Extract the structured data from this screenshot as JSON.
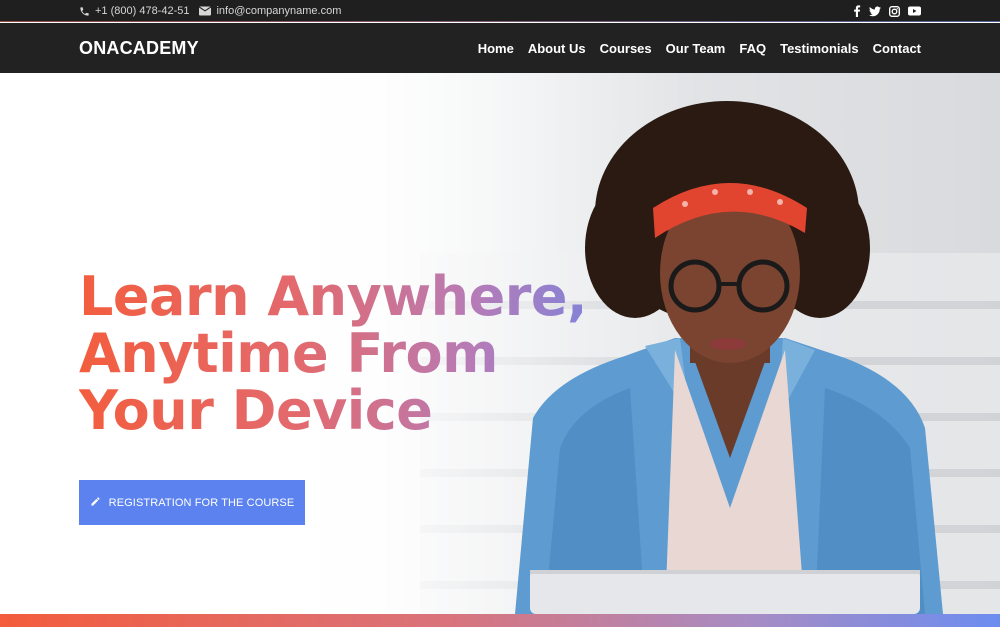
{
  "topbar": {
    "phone": "+1 (800) 478-42-51",
    "email": "info@companyname.com",
    "socials": [
      "facebook-icon",
      "twitter-icon",
      "instagram-icon",
      "youtube-icon"
    ]
  },
  "navbar": {
    "logo": "ONACADEMY",
    "links": [
      "Home",
      "About Us",
      "Courses",
      "Our Team",
      "FAQ",
      "Testimonials",
      "Contact"
    ]
  },
  "hero": {
    "headline": [
      "Learn Anywhere,",
      "Anytime From",
      "Your Device"
    ],
    "cta_label": "REGISTRATION FOR THE COURSE"
  },
  "colors": {
    "topbar_bg": "#1f1f1f",
    "navbar_bg": "#222222",
    "cta_bg": "#5b82ee",
    "gradient_start": "#f35d3e",
    "gradient_end": "#6f86e6"
  }
}
